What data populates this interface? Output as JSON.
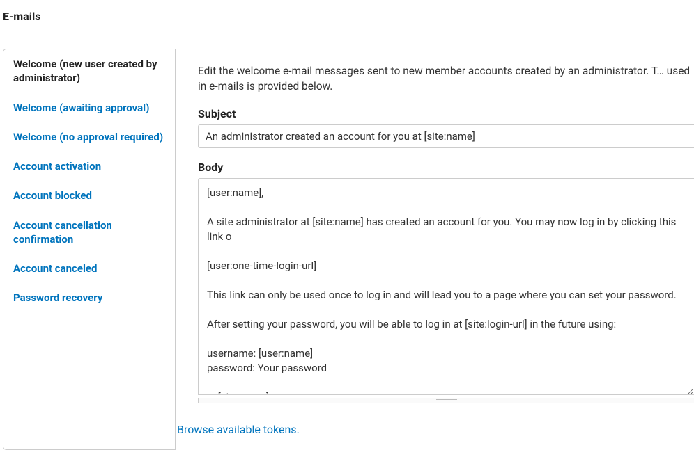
{
  "section_title": "E-mails",
  "tabs": [
    {
      "label": "Welcome (new user created by administrator)",
      "active": true
    },
    {
      "label": "Welcome (awaiting approval)",
      "active": false
    },
    {
      "label": "Welcome (no approval required)",
      "active": false
    },
    {
      "label": "Account activation",
      "active": false
    },
    {
      "label": "Account blocked",
      "active": false
    },
    {
      "label": "Account cancellation confirmation",
      "active": false
    },
    {
      "label": "Account canceled",
      "active": false
    },
    {
      "label": "Password recovery",
      "active": false
    }
  ],
  "description": "Edit the welcome e-mail messages sent to new member accounts created by an administrator. T… used in e-mails is provided below.",
  "subject_label": "Subject",
  "subject_value": "An administrator created an account for you at [site:name]",
  "body_label": "Body",
  "body_value": "[user:name],\n\nA site administrator at [site:name] has created an account for you. You may now log in by clicking this link o\n\n[user:one-time-login-url]\n\nThis link can only be used once to log in and will lead you to a page where you can set your password.\n\nAfter setting your password, you will be able to log in at [site:login-url] in the future using:\n\nusername: [user:name]\npassword: Your password\n\n--  [site:name] team",
  "tokens_link": "Browse available tokens."
}
